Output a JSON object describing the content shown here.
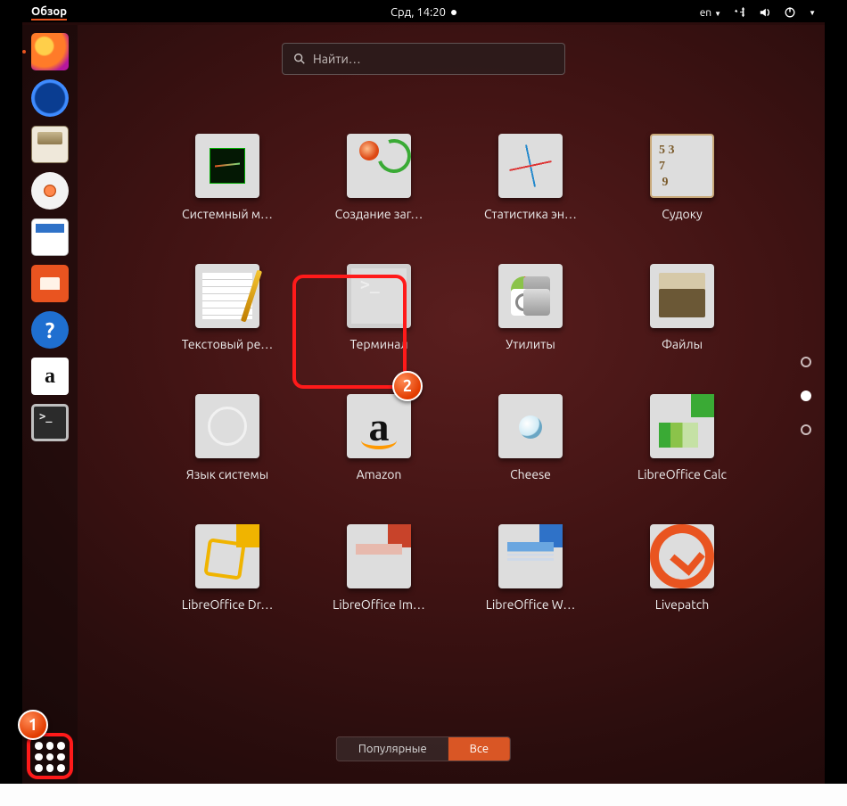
{
  "topbar": {
    "activities": "Обзор",
    "clock": "Срд, 14:20",
    "lang": "en"
  },
  "search": {
    "placeholder": "Найти…"
  },
  "dock": [
    {
      "name": "firefox",
      "label": "Firefox"
    },
    {
      "name": "thunderbird",
      "label": "Thunderbird"
    },
    {
      "name": "files",
      "label": "Файлы"
    },
    {
      "name": "rhythmbox",
      "label": "Rhythmbox"
    },
    {
      "name": "writer",
      "label": "LibreOffice Writer"
    },
    {
      "name": "software",
      "label": "Ubuntu Software"
    },
    {
      "name": "help",
      "label": "Справка"
    },
    {
      "name": "amazon",
      "label": "Amazon"
    },
    {
      "name": "terminal",
      "label": "Терминал"
    }
  ],
  "apps": [
    {
      "id": "sysmon",
      "label": "Системный м…"
    },
    {
      "id": "startup",
      "label": "Создание заг…"
    },
    {
      "id": "stats",
      "label": "Статистика эн…"
    },
    {
      "id": "sudoku",
      "label": "Судоку"
    },
    {
      "id": "text",
      "label": "Текстовый ре…"
    },
    {
      "id": "term",
      "label": "Терминал"
    },
    {
      "id": "util",
      "label": "Утилиты"
    },
    {
      "id": "files2",
      "label": "Файлы"
    },
    {
      "id": "lang",
      "label": "Язык системы"
    },
    {
      "id": "amazon",
      "label": "Amazon"
    },
    {
      "id": "cheese",
      "label": "Cheese"
    },
    {
      "id": "calc",
      "label": "LibreOffice Calc"
    },
    {
      "id": "draw",
      "label": "LibreOffice Dr…"
    },
    {
      "id": "impress",
      "label": "LibreOffice Im…"
    },
    {
      "id": "writer2",
      "label": "LibreOffice W…"
    },
    {
      "id": "livepatch",
      "label": "Livepatch"
    }
  ],
  "toggle": {
    "popular": "Популярные",
    "all": "Все",
    "active": "all"
  },
  "badges": {
    "one": "1",
    "two": "2"
  }
}
